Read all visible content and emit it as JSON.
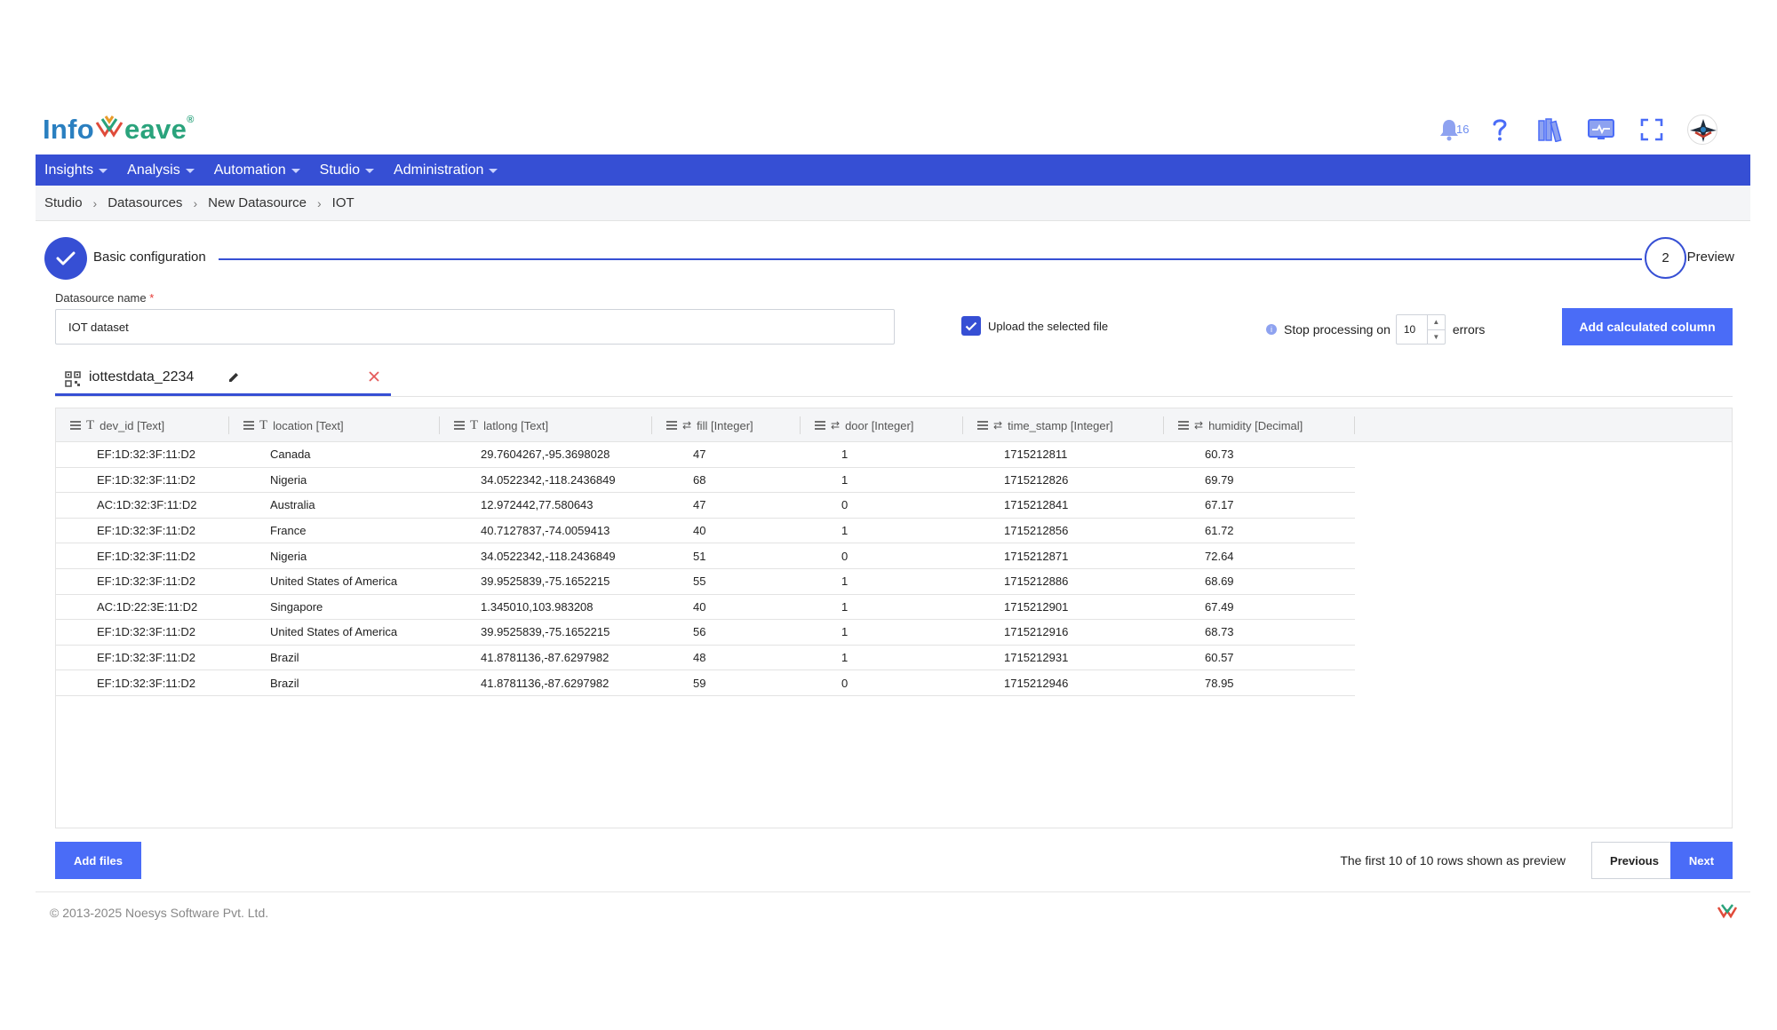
{
  "brand": {
    "name_part1": "Info",
    "name_part2": "eave",
    "reg": "®"
  },
  "header": {
    "notification_count": "16"
  },
  "nav": {
    "items": [
      "Insights",
      "Analysis",
      "Automation",
      "Studio",
      "Administration"
    ]
  },
  "breadcrumb": [
    "Studio",
    "Datasources",
    "New Datasource",
    "IOT"
  ],
  "stepper": {
    "step1_label": "Basic configuration",
    "step2_number": "2",
    "step2_label": "Preview"
  },
  "form": {
    "datasource_label": "Datasource name",
    "required_mark": "*",
    "datasource_value": "IOT dataset",
    "upload_label": "Upload the selected file",
    "upload_checked": true,
    "stop_label": "Stop processing on",
    "stop_value": "10",
    "errors_label": "errors",
    "add_calc_label": "Add calculated column"
  },
  "file_tab": {
    "name": "iottestdata_2234"
  },
  "table": {
    "columns": [
      {
        "label": "dev_id [Text]",
        "type": "text"
      },
      {
        "label": "location [Text]",
        "type": "text"
      },
      {
        "label": "latlong [Text]",
        "type": "text"
      },
      {
        "label": "fill [Integer]",
        "type": "number"
      },
      {
        "label": "door [Integer]",
        "type": "number"
      },
      {
        "label": "time_stamp [Integer]",
        "type": "number"
      },
      {
        "label": "humidity [Decimal]",
        "type": "number"
      }
    ],
    "rows": [
      [
        "EF:1D:32:3F:11:D2",
        "Canada",
        "29.7604267,-95.3698028",
        "47",
        "1",
        "1715212811",
        "60.73"
      ],
      [
        "EF:1D:32:3F:11:D2",
        "Nigeria",
        "34.0522342,-118.2436849",
        "68",
        "1",
        "1715212826",
        "69.79"
      ],
      [
        "AC:1D:32:3F:11:D2",
        "Australia",
        "12.972442,77.580643",
        "47",
        "0",
        "1715212841",
        "67.17"
      ],
      [
        "EF:1D:32:3F:11:D2",
        "France",
        "40.7127837,-74.0059413",
        "40",
        "1",
        "1715212856",
        "61.72"
      ],
      [
        "EF:1D:32:3F:11:D2",
        "Nigeria",
        "34.0522342,-118.2436849",
        "51",
        "0",
        "1715212871",
        "72.64"
      ],
      [
        "EF:1D:32:3F:11:D2",
        "United States of America",
        "39.9525839,-75.1652215",
        "55",
        "1",
        "1715212886",
        "68.69"
      ],
      [
        "AC:1D:22:3E:11:D2",
        "Singapore",
        "1.345010,103.983208",
        "40",
        "1",
        "1715212901",
        "67.49"
      ],
      [
        "EF:1D:32:3F:11:D2",
        "United States of America",
        "39.9525839,-75.1652215",
        "56",
        "1",
        "1715212916",
        "68.73"
      ],
      [
        "EF:1D:32:3F:11:D2",
        "Brazil",
        "41.8781136,-87.6297982",
        "48",
        "1",
        "1715212931",
        "60.57"
      ],
      [
        "EF:1D:32:3F:11:D2",
        "Brazil",
        "41.8781136,-87.6297982",
        "59",
        "0",
        "1715212946",
        "78.95"
      ]
    ]
  },
  "footer_actions": {
    "add_files_label": "Add files",
    "preview_note": "The first 10 of 10 rows shown as preview",
    "previous_label": "Previous",
    "next_label": "Next"
  },
  "footer": {
    "copyright": "© 2013-2025 Noesys Software Pvt. Ltd."
  },
  "colors": {
    "primary": "#364fd4",
    "button": "#4a6cf7",
    "error": "#e53935"
  }
}
